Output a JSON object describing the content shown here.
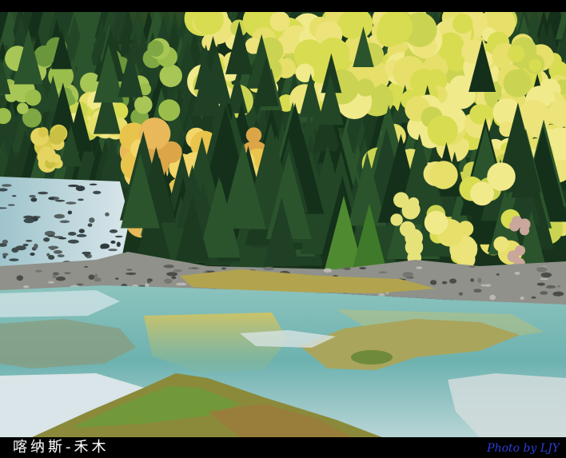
{
  "photo": {
    "caption": "喀纳斯-禾木",
    "credit": "Photo by LJY"
  },
  "colors": {
    "border": "#000000",
    "caption_text": "#ffffff",
    "credit_text": "#2b3fd6",
    "forest_dark": "#1c3a20",
    "foliage_yellow": "#e6df6a",
    "river_turquoise": "#7cbcb8"
  }
}
